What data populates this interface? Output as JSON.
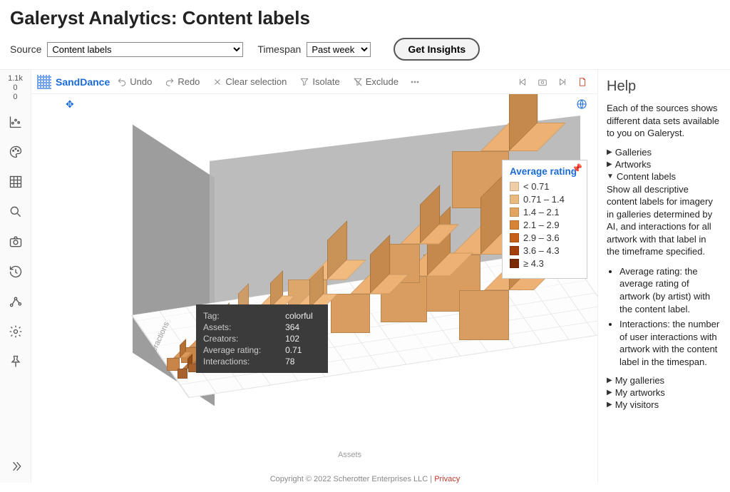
{
  "page": {
    "title": "Galeryst Analytics: Content labels"
  },
  "filters": {
    "source_label": "Source",
    "source_value": "Content labels",
    "timespan_label": "Timespan",
    "timespan_value": "Past week",
    "insights_button": "Get Insights"
  },
  "brand": "SandDance",
  "toolbar": {
    "undo": "Undo",
    "redo": "Redo",
    "clear": "Clear selection",
    "isolate": "Isolate",
    "exclude": "Exclude"
  },
  "scale": {
    "top": "1.1k",
    "mid": "0",
    "bot": "0"
  },
  "axis": {
    "x": "Assets",
    "y": "Interactions"
  },
  "chart_data": {
    "type": "scatter",
    "title": "",
    "xlabel": "Assets",
    "ylabel": "Interactions",
    "legend_title": "Average rating",
    "legend_bins": [
      {
        "label": "< 0.71",
        "color": "#f0cda6"
      },
      {
        "label": "0.71 – 1.4",
        "color": "#e9b97f"
      },
      {
        "label": "1.4 – 2.1",
        "color": "#e2a561"
      },
      {
        "label": "2.1 – 2.9",
        "color": "#d88436"
      },
      {
        "label": "2.9 – 3.6",
        "color": "#c55f17"
      },
      {
        "label": "3.6 – 4.3",
        "color": "#a23f0b"
      },
      {
        "label": "≥ 4.3",
        "color": "#7c2a05"
      }
    ],
    "hovered_point": {
      "Tag": "colorful",
      "Assets": 364,
      "Creators": 102,
      "Average rating": 0.71,
      "Interactions": 78
    }
  },
  "tooltip": {
    "rows": [
      {
        "k": "Tag:",
        "v": "colorful"
      },
      {
        "k": "Assets:",
        "v": "364"
      },
      {
        "k": "Creators:",
        "v": "102"
      },
      {
        "k": "Average rating:",
        "v": "0.71"
      },
      {
        "k": "Interactions:",
        "v": "78"
      }
    ]
  },
  "help": {
    "title": "Help",
    "intro": "Each of the sources shows different data sets available to you on Galeryst.",
    "tree_top": [
      {
        "label": "Galleries",
        "open": false
      },
      {
        "label": "Artworks",
        "open": false
      },
      {
        "label": "Content labels",
        "open": true
      }
    ],
    "content_labels_desc": "Show all descriptive content labels for imagery in galleries determined by AI, and interactions for all artwork with that label in the timeframe specified.",
    "bullets": [
      "Average rating: the average rating of artwork (by artist) with the content label.",
      "Interactions: the number of user interactions with artwork with the content label in the timespan."
    ],
    "tree_bottom": [
      {
        "label": "My galleries"
      },
      {
        "label": "My artworks"
      },
      {
        "label": "My visitors"
      }
    ]
  },
  "footer": {
    "text": "Copyright © 2022 Scherotter Enterprises LLC | ",
    "link": "Privacy"
  }
}
